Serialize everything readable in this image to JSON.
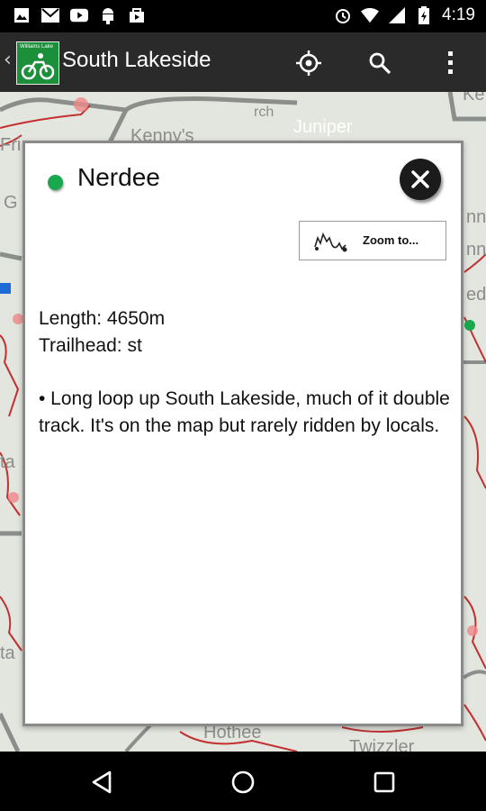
{
  "status_bar": {
    "time": "4:19",
    "left_icons": [
      "image-icon",
      "gmail-icon",
      "youtube-icon",
      "android-icon",
      "bag-icon"
    ],
    "right_icons": [
      "alarm-icon",
      "wifi-icon",
      "signal-icon",
      "battery-icon"
    ]
  },
  "action_bar": {
    "logo_text": "Williams Lake",
    "title": "South Lakeside",
    "buttons": [
      "locate-icon",
      "search-icon",
      "overflow-menu-icon"
    ]
  },
  "map": {
    "labels": [
      "Kenny's",
      "Juniper",
      "Fri",
      "G",
      "nn",
      "nn",
      "ed",
      "ta",
      "ta",
      "Hothee",
      "Twizzler",
      "Ke",
      "rch"
    ]
  },
  "dialog": {
    "trail_name": "Nerdee",
    "trail_color": "#1aa84f",
    "zoom_label": "Zoom to...",
    "length": "Length: 4650m",
    "trailhead": "Trailhead: st",
    "description": "• Long loop up South Lakeside, much of it double track. It's on the map but rarely ridden by locals."
  },
  "nav_bar": {
    "buttons": [
      "back-icon",
      "home-icon",
      "recents-icon"
    ]
  }
}
